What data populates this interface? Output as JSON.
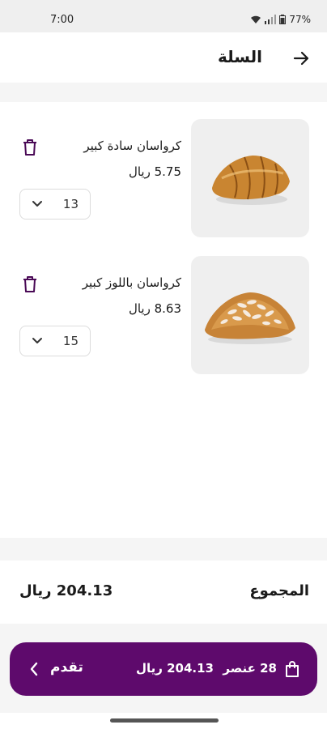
{
  "status_bar": {
    "time": "7:00",
    "battery": "77%"
  },
  "header": {
    "title": "السلة"
  },
  "items": [
    {
      "name": "كرواسان سادة كبير",
      "price": "5.75 ريال",
      "quantity": "13",
      "icon": "plain-croissant-image"
    },
    {
      "name": "كرواسان باللوز كبير",
      "price": "8.63 ريال",
      "quantity": "15",
      "icon": "almond-croissant-image"
    }
  ],
  "summary": {
    "total_label": "المجموع",
    "total_value": "204.13 ريال"
  },
  "checkout": {
    "count": "28 عنصر",
    "total": "204.13 ريال",
    "proceed_label": "تقدم"
  },
  "colors": {
    "primary": "#5e0a6c",
    "background": "#ffffff",
    "separator": "#f5f5f5",
    "image_bg": "#efefef"
  }
}
